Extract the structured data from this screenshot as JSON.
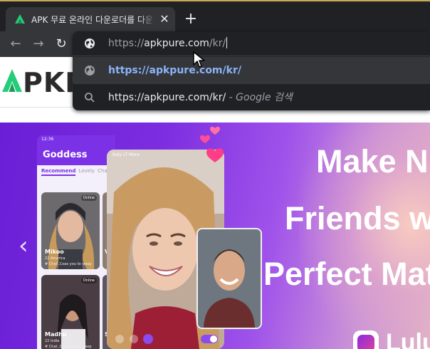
{
  "tab": {
    "title": "APK 무료 온라인 다운로더를 다운로드",
    "close_glyph": "✕"
  },
  "toolbar": {
    "back_glyph": "←",
    "forward_glyph": "→",
    "reload_glyph": "↻",
    "new_tab_glyph": "+"
  },
  "omnibox": {
    "scheme": "https://",
    "host": "apkpure.com",
    "path": "/kr/",
    "suggestions": [
      {
        "label": "https://apkpure.com/kr/",
        "description": "",
        "icon": "globe-icon"
      },
      {
        "label": "https://apkpure.com/kr/",
        "description": " - Google 검색",
        "icon": "search-icon"
      }
    ]
  },
  "site": {
    "logo_text": "PKP"
  },
  "banner": {
    "prev_glyph": "‹",
    "headline": [
      "Make N",
      "Friends w",
      "Perfect Mat"
    ],
    "app_name": "Lulu",
    "phone": {
      "status_time": "12:36",
      "title": "Goddess",
      "tabs": [
        "Recommend",
        "Lovely",
        "Chas"
      ],
      "video_label": "Italy LT More",
      "cards": [
        {
          "name": "Mikoo",
          "age": "22 America",
          "chat": "# Chat ,Coax you to sleep",
          "online": "Online"
        },
        {
          "name": "Madhu",
          "age": "22 India",
          "chat": "# Chat ,Coax you to sleep",
          "online": "Online"
        }
      ],
      "side_cards": [
        "Vi",
        "Sw"
      ]
    },
    "colors": {
      "brand": "#7b32e6",
      "accent": "#8a4bf0"
    }
  },
  "theme": {
    "tab_bg": "#35363a",
    "strip_bg": "#202124",
    "link_blue": "#8ab4f8",
    "logo_green": "#24cd77"
  }
}
